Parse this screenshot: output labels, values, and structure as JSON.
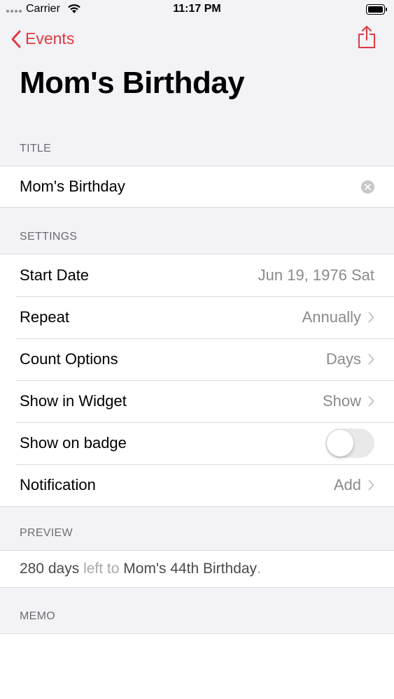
{
  "status_bar": {
    "carrier": "Carrier",
    "time": "11:17 PM"
  },
  "nav": {
    "back_label": "Events",
    "accent_color": "#e03a3f"
  },
  "page_title": "Mom's Birthday",
  "sections": {
    "title_header": "TITLE",
    "settings_header": "SETTINGS",
    "preview_header": "PREVIEW",
    "memo_header": "MEMO"
  },
  "title_field": {
    "value": "Mom's Birthday"
  },
  "settings": {
    "start_date": {
      "label": "Start Date",
      "value": "Jun 19, 1976 Sat"
    },
    "repeat": {
      "label": "Repeat",
      "value": "Annually"
    },
    "count_options": {
      "label": "Count Options",
      "value": "Days"
    },
    "show_in_widget": {
      "label": "Show in Widget",
      "value": "Show"
    },
    "show_on_badge": {
      "label": "Show on badge",
      "enabled": false
    },
    "notification": {
      "label": "Notification",
      "value": "Add"
    }
  },
  "preview": {
    "count": "280 days",
    "connector": "left to",
    "event": "Mom's 44th Birthday",
    "period": "."
  }
}
